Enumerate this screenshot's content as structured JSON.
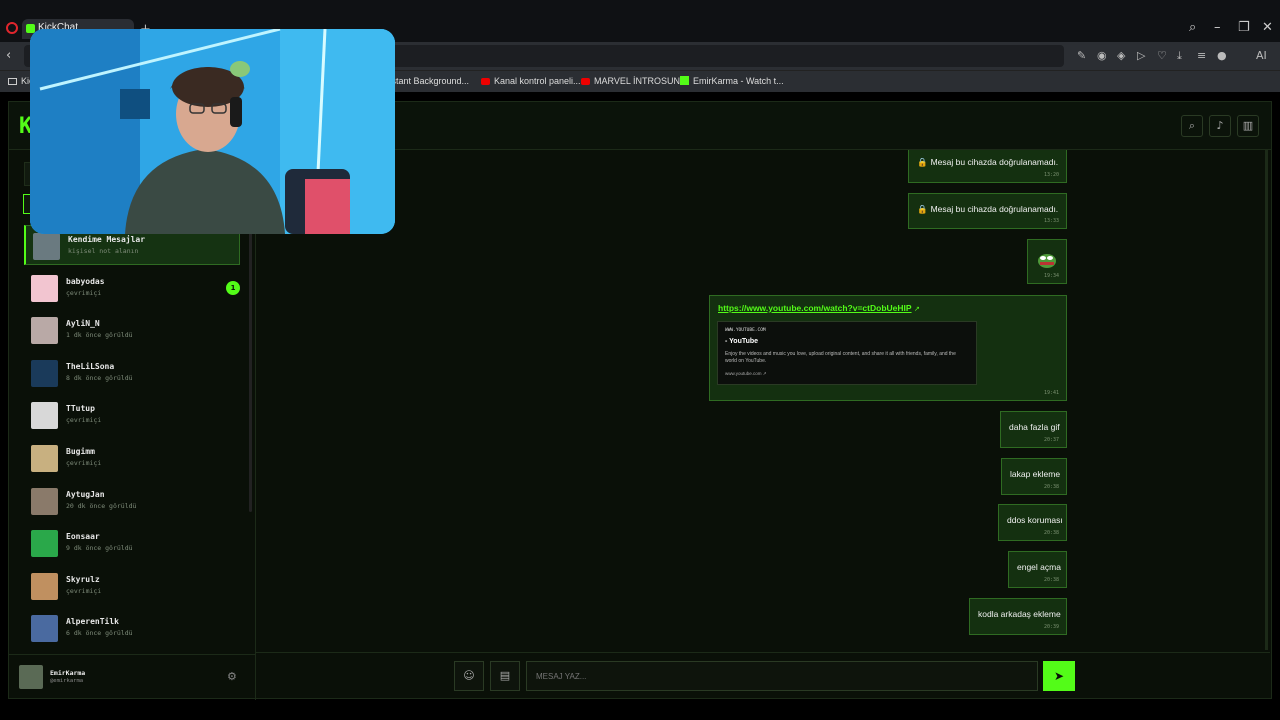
{
  "browser": {
    "tab_title": "KickChat",
    "bookmarks": [
      {
        "label": "Kick",
        "icon": "folder-icon"
      },
      {
        "label": "Instant Background...",
        "icon": "folder-icon"
      },
      {
        "label": "Kanal kontrol paneli...",
        "icon": "youtube-icon"
      },
      {
        "label": "MARVEL İNTROSUN...",
        "icon": "youtube-icon"
      },
      {
        "label": "EmirKarma - Watch t...",
        "icon": "kick-icon"
      }
    ],
    "ai_label": "AI"
  },
  "app": {
    "logo": "K",
    "accent": "#53fc18"
  },
  "contacts": [
    {
      "name": "Kendime Mesajlar",
      "status": "kişisel not alanın",
      "active": true,
      "avatar_color": "#6a7a80"
    },
    {
      "name": "babyodas",
      "status": "çevrimiçi",
      "unread": "1",
      "avatar_color": "#f2c5d0"
    },
    {
      "name": "AyliN_N",
      "status": "1 dk önce görüldü",
      "avatar_color": "#b9a9a6"
    },
    {
      "name": "TheLiLSona",
      "status": "8 dk önce görüldü",
      "avatar_color": "#1a3a5a"
    },
    {
      "name": "TTutup",
      "status": "çevrimiçi",
      "avatar_color": "#d8d8d8"
    },
    {
      "name": "Bugimm",
      "status": "çevrimiçi",
      "avatar_color": "#c8b080"
    },
    {
      "name": "AytugJan",
      "status": "20 dk önce görüldü",
      "avatar_color": "#8a7a6a"
    },
    {
      "name": "Eonsaar",
      "status": "9 dk önce görüldü",
      "avatar_color": "#2aa84a"
    },
    {
      "name": "Skyrulz",
      "status": "çevrimiçi",
      "avatar_color": "#c09060"
    },
    {
      "name": "AlperenTilk",
      "status": "6 dk önce görüldü",
      "avatar_color": "#4a6aa0"
    }
  ],
  "me": {
    "name": "EmirKarma",
    "handle": "@emirkarma"
  },
  "messages": [
    {
      "text": "Mesaj bu cihazda doğrulanamadı.",
      "time": "13:20",
      "locked": true
    },
    {
      "text": "Mesaj bu cihazda doğrulanamadı.",
      "time": "13:33",
      "locked": true
    },
    {
      "text": "",
      "time": "19:34",
      "sticker": true
    },
    {
      "link": "https://www.youtube.com/watch?v=ctDobUeHIP",
      "time": "19:41",
      "preview": {
        "domain": "WWW.YOUTUBE.COM",
        "title": "- YouTube",
        "description": "Enjoy the videos and music you love, upload original content, and share it all with friends, family, and the world on YouTube.",
        "footer": "www.youtube.com"
      }
    },
    {
      "text": "daha fazla gif",
      "time": "20:37"
    },
    {
      "text": "lakap ekleme",
      "time": "20:38"
    },
    {
      "text": "ddos koruması",
      "time": "20:38"
    },
    {
      "text": "engel açma",
      "time": "20:38"
    },
    {
      "text": "kodla arkadaş ekleme",
      "time": "20:39"
    }
  ],
  "composer": {
    "placeholder": "MESAJ YAZ..."
  }
}
